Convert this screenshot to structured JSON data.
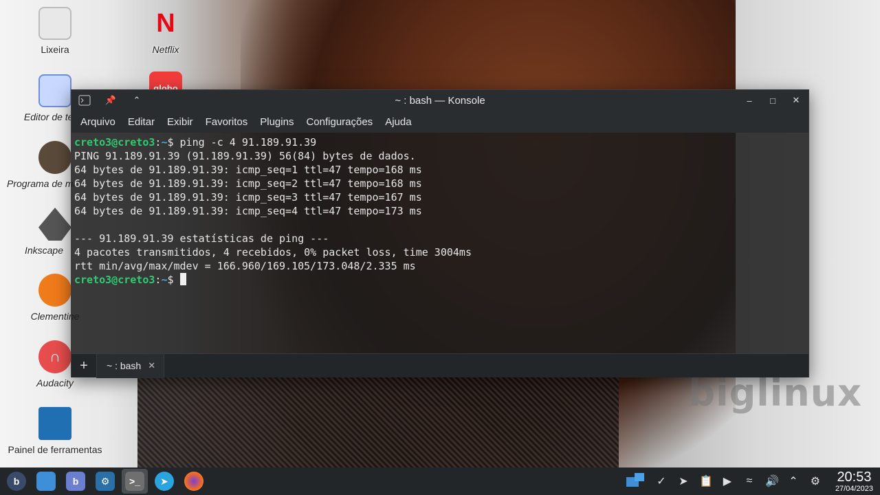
{
  "desktop": {
    "wallpaper_brand": "biglinux",
    "icons": [
      {
        "label": "Lixeira",
        "icon": "trash-icon"
      },
      {
        "label": "Netflix",
        "icon": "netflix-icon"
      },
      {
        "label": "Editor de texto",
        "icon": "text-editor-icon"
      },
      {
        "label": "globo",
        "icon": "globo-icon"
      },
      {
        "label": "Programa de manipulação",
        "icon": "gimp-icon"
      },
      {
        "label": "Inkscape",
        "icon": "inkscape-icon"
      },
      {
        "label": "Clementine",
        "icon": "clementine-icon"
      },
      {
        "label": "Audacity",
        "icon": "audacity-icon"
      },
      {
        "label": "Painel de ferramentas",
        "icon": "tools-panel-icon"
      }
    ]
  },
  "window": {
    "title": "~ : bash — Konsole",
    "menu": [
      "Arquivo",
      "Editar",
      "Exibir",
      "Favoritos",
      "Plugins",
      "Configurações",
      "Ajuda"
    ],
    "terminal": {
      "user": "creto3@creto3",
      "path": "~",
      "command": "ping -c 4 91.189.91.39",
      "output": [
        "PING 91.189.91.39 (91.189.91.39) 56(84) bytes de dados.",
        "64 bytes de 91.189.91.39: icmp_seq=1 ttl=47 tempo=168 ms",
        "64 bytes de 91.189.91.39: icmp_seq=2 ttl=47 tempo=168 ms",
        "64 bytes de 91.189.91.39: icmp_seq=3 ttl=47 tempo=167 ms",
        "64 bytes de 91.189.91.39: icmp_seq=4 ttl=47 tempo=173 ms",
        "",
        "--- 91.189.91.39 estatísticas de ping ---",
        "4 pacotes transmitidos, 4 recebidos, 0% packet loss, time 3004ms",
        "rtt min/avg/max/mdev = 166.960/169.105/173.048/2.335 ms"
      ]
    },
    "tab_label": "~ : bash"
  },
  "taskbar": {
    "clock_time": "20:53",
    "clock_date": "27/04/2023"
  }
}
